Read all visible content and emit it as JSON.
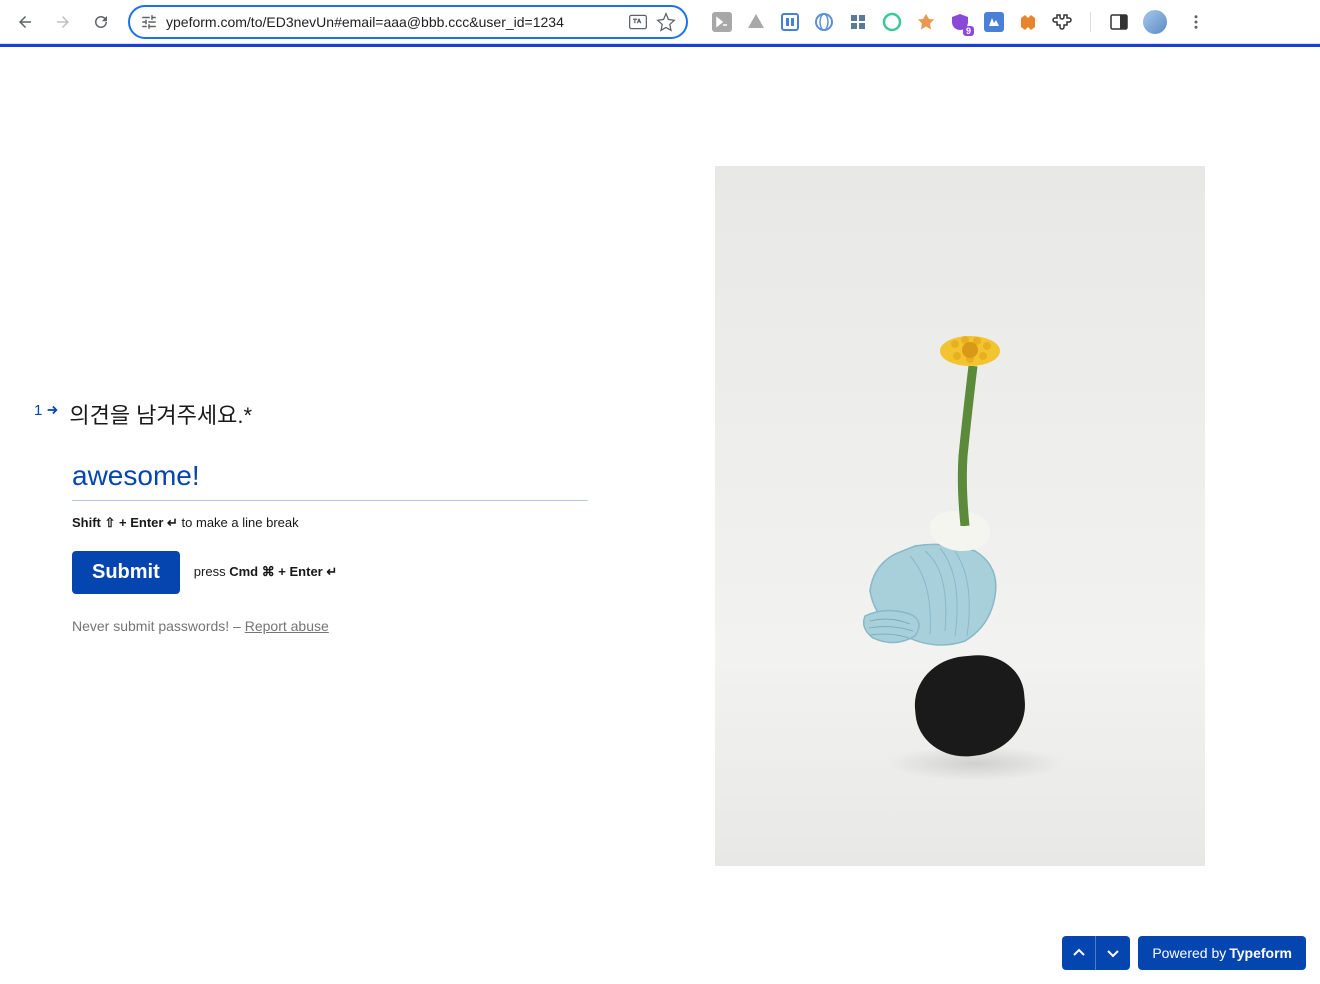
{
  "browser": {
    "url": "ypeform.com/to/ED3nevUn#email=aaa@bbb.ccc&user_id=1234"
  },
  "question": {
    "number": "1",
    "text": "의견을 남겨주세요.*"
  },
  "answer": {
    "value": "awesome!"
  },
  "hints": {
    "line_break_bold": "Shift ⇧ + Enter ↵",
    "line_break_rest": " to make a line break",
    "press_prefix": "press ",
    "press_bold": "Cmd ⌘ + Enter ↵"
  },
  "buttons": {
    "submit": "Submit"
  },
  "warning": {
    "prefix": "Never submit passwords! – ",
    "link": "Report abuse"
  },
  "footer": {
    "powered_prefix": "Powered by ",
    "powered_brand": "Typeform"
  }
}
